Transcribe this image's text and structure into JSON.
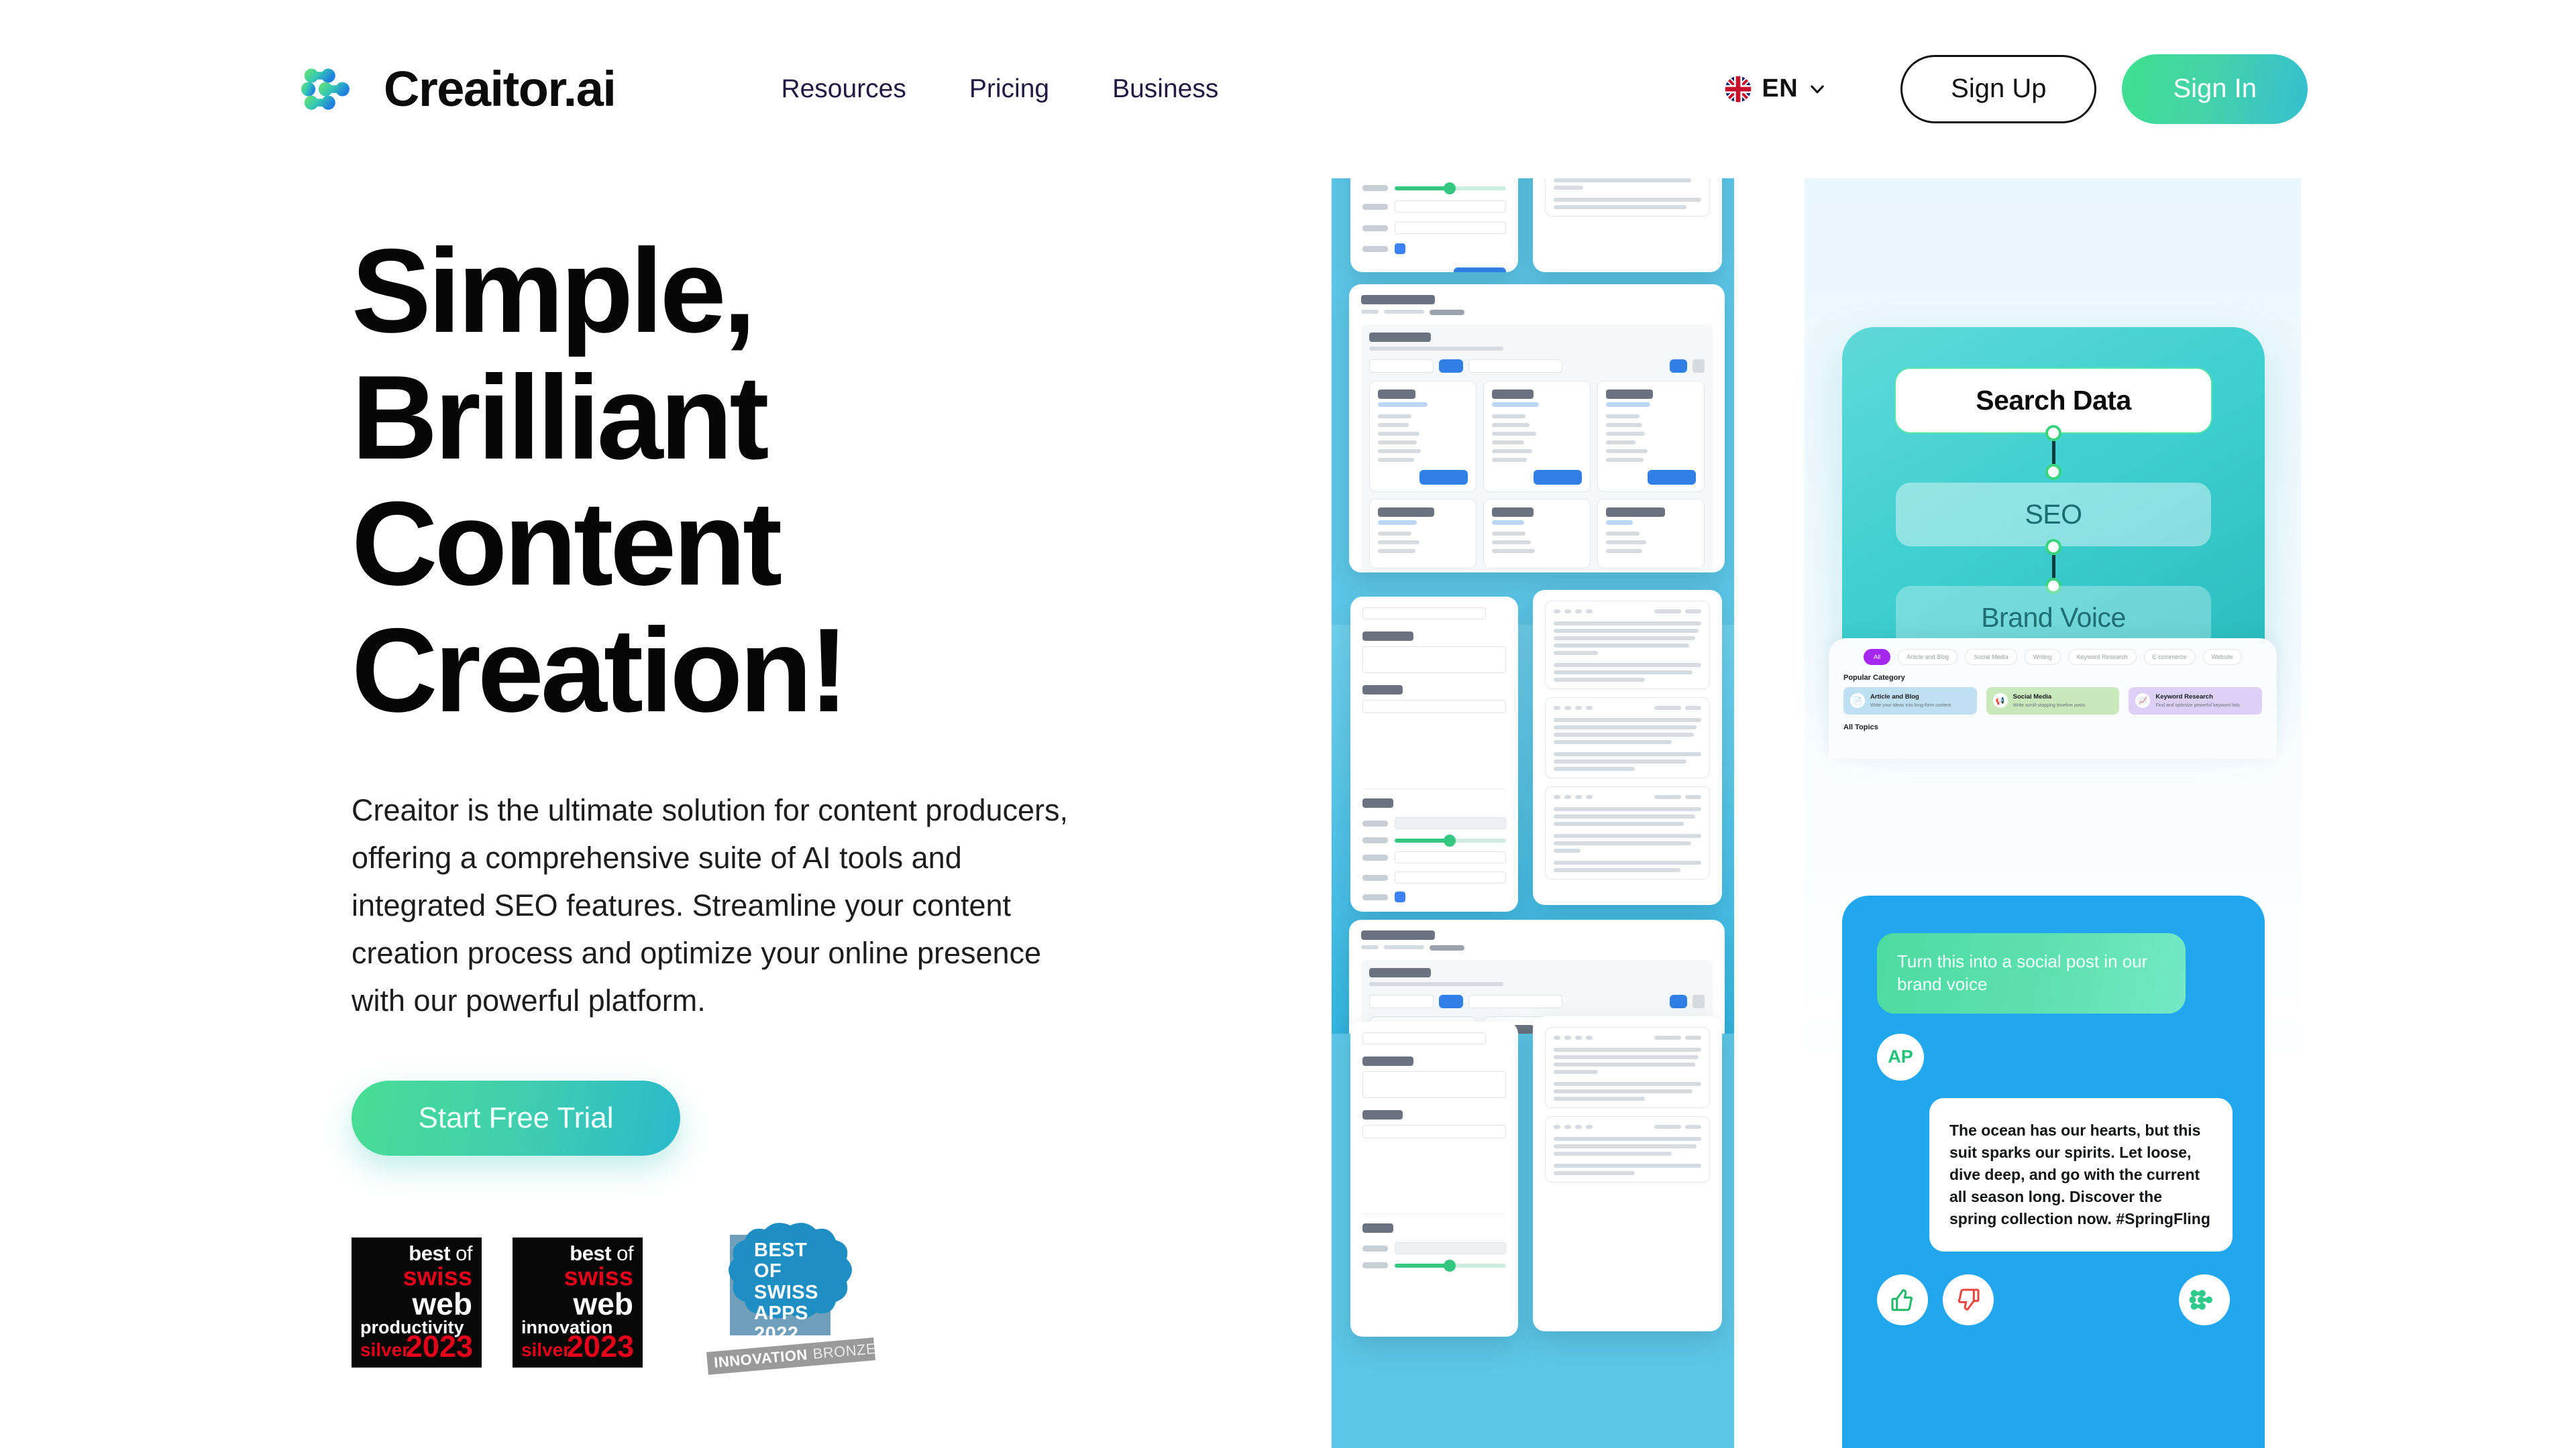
{
  "header": {
    "brand_name": "Creaitor.ai",
    "logo_icon": "creaitor-nodes-logo",
    "nav": [
      {
        "label": "Resources",
        "name": "resources"
      },
      {
        "label": "Pricing",
        "name": "pricing"
      },
      {
        "label": "Business",
        "name": "business"
      }
    ],
    "language": {
      "code": "EN",
      "flag_icon": "uk-flag-icon",
      "chevron_icon": "chevron-down-icon"
    },
    "sign_up_label": "Sign Up",
    "sign_in_label": "Sign In"
  },
  "hero": {
    "headline_lines": [
      "Simple,",
      "Brilliant",
      "Content",
      "Creation!"
    ],
    "headline_full": "Simple, Brilliant Content Creation!",
    "paragraph": "Creaitor is the ultimate solution for content producers, offering a comprehensive suite of AI tools and integrated SEO features. Streamline your content creation process and optimize your online presence with our powerful platform.",
    "cta_label": "Start Free Trial"
  },
  "awards": [
    {
      "name": "best-of-swiss-web-productivity",
      "line1_bold": "best",
      "line1_light": " of",
      "line2": "swiss",
      "line3": "web",
      "category": "productivity",
      "rank": "silver",
      "year": "2023"
    },
    {
      "name": "best-of-swiss-web-innovation",
      "line1_bold": "best",
      "line1_light": " of",
      "line2": "swiss",
      "line3": "web",
      "category": "innovation",
      "rank": "silver",
      "year": "2023"
    },
    {
      "name": "best-of-swiss-apps",
      "title": "BEST\nOF\nSWISS\nAPPS\n2022",
      "ribbon_bold": "INNOVATION",
      "ribbon_light": "BRONZE"
    }
  ],
  "flow": {
    "step1": "Search Data",
    "step2": "SEO",
    "step3": "Brand Voice"
  },
  "category_panel": {
    "chips": [
      "All",
      "Article and Blog",
      "Social Media",
      "Writing",
      "Keyword Research",
      "E-commerce",
      "Website"
    ],
    "active_chip": "All",
    "popular_label": "Popular Category",
    "all_topics_label": "All Topics",
    "cards": [
      {
        "title": "Article and Blog",
        "subtitle": "Write your ideas into long-form content",
        "color": "#bfe0f2"
      },
      {
        "title": "Social Media",
        "subtitle": "Write scroll-stopping timeline posts",
        "color": "#c9e9bd"
      },
      {
        "title": "Keyword Research",
        "subtitle": "Find and optimize powerful keyword lists",
        "color": "#ddd0f7"
      }
    ]
  },
  "chat": {
    "user_message": "Turn this into a social post in our brand voice",
    "avatar_initials": "AP",
    "ai_message": "The ocean has our hearts, but this suit sparks our spirits. Let loose, dive deep, and go with the current all season long. Discover the spring collection now. #SpringFling",
    "thumbs_up_icon": "thumbs-up-icon",
    "thumbs_down_icon": "thumbs-down-icon",
    "logo_action_icon": "creaitor-nodes-logo-icon"
  },
  "colors": {
    "brand_green": "#3fe08f",
    "brand_teal": "#2cb9cc",
    "nav_text": "#231942",
    "panel_blue": "#5BC6E8",
    "chat_blue": "#22A7EE",
    "award_red": "#e2001a",
    "chip_purple": "#a428f0"
  }
}
